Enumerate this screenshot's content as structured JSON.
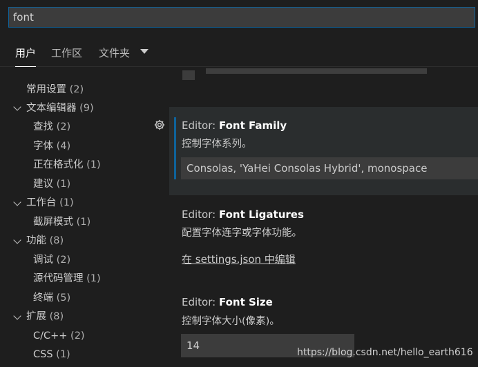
{
  "search": {
    "value": "font"
  },
  "tabs": {
    "user": "用户",
    "workspace": "工作区",
    "folder": "文件夹"
  },
  "toc": [
    {
      "label": "常用设置",
      "count": "(2)",
      "expandable": false
    },
    {
      "label": "文本编辑器",
      "count": "(9)",
      "expandable": true
    },
    {
      "label": "查找",
      "count": "(2)",
      "expandable": false
    },
    {
      "label": "字体",
      "count": "(4)",
      "expandable": false
    },
    {
      "label": "正在格式化",
      "count": "(1)",
      "expandable": false
    },
    {
      "label": "建议",
      "count": "(1)",
      "expandable": false
    },
    {
      "label": "工作台",
      "count": "(1)",
      "expandable": true
    },
    {
      "label": "截屏模式",
      "count": "(1)",
      "expandable": false
    },
    {
      "label": "功能",
      "count": "(8)",
      "expandable": true
    },
    {
      "label": "调试",
      "count": "(2)",
      "expandable": false
    },
    {
      "label": "源代码管理",
      "count": "(1)",
      "expandable": false
    },
    {
      "label": "终端",
      "count": "(5)",
      "expandable": false
    },
    {
      "label": "扩展",
      "count": "(8)",
      "expandable": true
    },
    {
      "label": "C/C++",
      "count": "(2)",
      "expandable": false
    },
    {
      "label": "CSS",
      "count": "(1)",
      "expandable": false
    }
  ],
  "settings": {
    "font_family": {
      "category": "Editor: ",
      "name": "Font Family",
      "description": "控制字体系列。",
      "value": "Consolas, 'YaHei Consolas Hybrid', monospace"
    },
    "font_ligatures": {
      "category": "Editor: ",
      "name": "Font Ligatures",
      "description": "配置字体连字或字体功能。",
      "link": "在 settings.json 中编辑"
    },
    "font_size": {
      "category": "Editor: ",
      "name": "Font Size",
      "description": "控制字体大小(像素)。",
      "value": "14"
    }
  },
  "watermark": "https://blog.csdn.net/hello_earth616"
}
